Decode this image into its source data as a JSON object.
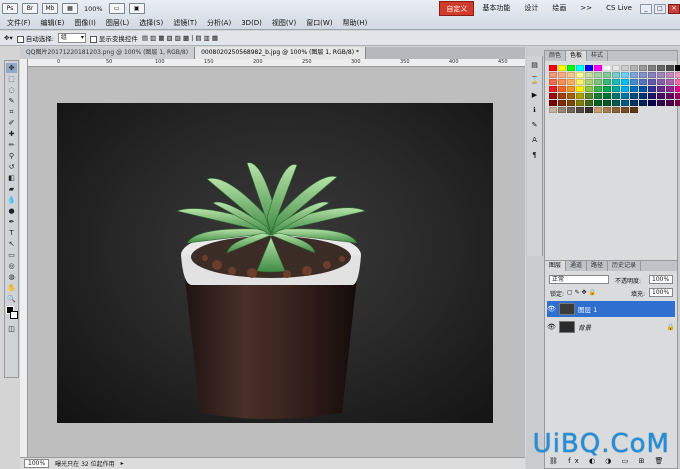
{
  "app_icons": [
    "Ps",
    "Br",
    "Mb"
  ],
  "zoom_top": "100%",
  "menu": [
    "文件(F)",
    "编辑(E)",
    "图像(I)",
    "图层(L)",
    "选择(S)",
    "滤镜(T)",
    "分析(A)",
    "3D(D)",
    "视图(V)",
    "窗口(W)",
    "帮助(H)"
  ],
  "workspaces": {
    "active": "自定义",
    "items": [
      "基本功能",
      "设计",
      "绘画"
    ],
    "more": ">>",
    "cslive": "CS Live"
  },
  "window_controls": [
    "_",
    "□",
    "✕"
  ],
  "options": {
    "auto_select": "自动选择:",
    "auto_select_value": "组",
    "show_transform": "显示变换控件"
  },
  "tabs": [
    "QQ图片20171220181203.png @ 100% (图层 1, RGB/8)",
    "0008020250568982_b.jpg @ 100% (图层 1, RGB/8) *"
  ],
  "ruler_ticks": [
    "0",
    "50",
    "100",
    "150",
    "200",
    "250",
    "300",
    "350",
    "400",
    "450"
  ],
  "status": {
    "zoom": "100%",
    "info": "曝光只在 32 位起作用"
  },
  "swatch_tabs": [
    "颜色",
    "色板",
    "样式"
  ],
  "swatch_colors": [
    "#ff0000",
    "#ffff00",
    "#00ff00",
    "#00ffff",
    "#0000ff",
    "#ff00ff",
    "#ffffff",
    "#e6e6e6",
    "#cccccc",
    "#b3b3b3",
    "#999999",
    "#808080",
    "#666666",
    "#4d4d4d",
    "#000000",
    "#f7977a",
    "#fbad82",
    "#fdc68c",
    "#fff799",
    "#c4df9b",
    "#a3d39c",
    "#82ca9c",
    "#7accc8",
    "#6dcff6",
    "#7da7d9",
    "#8393ca",
    "#8781bd",
    "#a186be",
    "#bd8cbf",
    "#f49ac1",
    "#f26c4f",
    "#f68e55",
    "#fbaf5c",
    "#fff467",
    "#acd372",
    "#7cc576",
    "#3bb878",
    "#1abbb4",
    "#00bff3",
    "#438cca",
    "#5574b9",
    "#605ca8",
    "#855fa8",
    "#a763a8",
    "#f06ea9",
    "#ed1c24",
    "#f26522",
    "#f7941d",
    "#fff200",
    "#8dc73f",
    "#39b54a",
    "#00a651",
    "#00a99d",
    "#00aeef",
    "#0072bc",
    "#0054a6",
    "#2e3192",
    "#662d91",
    "#92278f",
    "#ec008c",
    "#9e0b0f",
    "#a0410d",
    "#a3620a",
    "#aba000",
    "#598527",
    "#1a7b30",
    "#007236",
    "#00746b",
    "#0076a3",
    "#004b80",
    "#003471",
    "#1b1464",
    "#440e62",
    "#630460",
    "#9e005d",
    "#790000",
    "#7b2e00",
    "#7d4900",
    "#827b00",
    "#406618",
    "#005e20",
    "#005826",
    "#005952",
    "#005b7f",
    "#003663",
    "#002157",
    "#0d004c",
    "#32004b",
    "#4b0049",
    "#7b0046",
    "#c7b299",
    "#998675",
    "#736357",
    "#534741",
    "#37302d",
    "#c69c6d",
    "#a67c52",
    "#8c6239",
    "#754c24",
    "#603913"
  ],
  "layers": {
    "tabs": [
      "图层",
      "通道",
      "路径",
      "历史记录"
    ],
    "blend": "正常",
    "opacity_label": "不透明度:",
    "opacity": "100%",
    "lock_label": "锁定:",
    "fill_label": "填充:",
    "fill": "100%",
    "items": [
      {
        "name": "图层 1",
        "selected": true
      },
      {
        "name": "背景",
        "selected": false
      }
    ]
  },
  "watermark": "UiBQ.CoM"
}
